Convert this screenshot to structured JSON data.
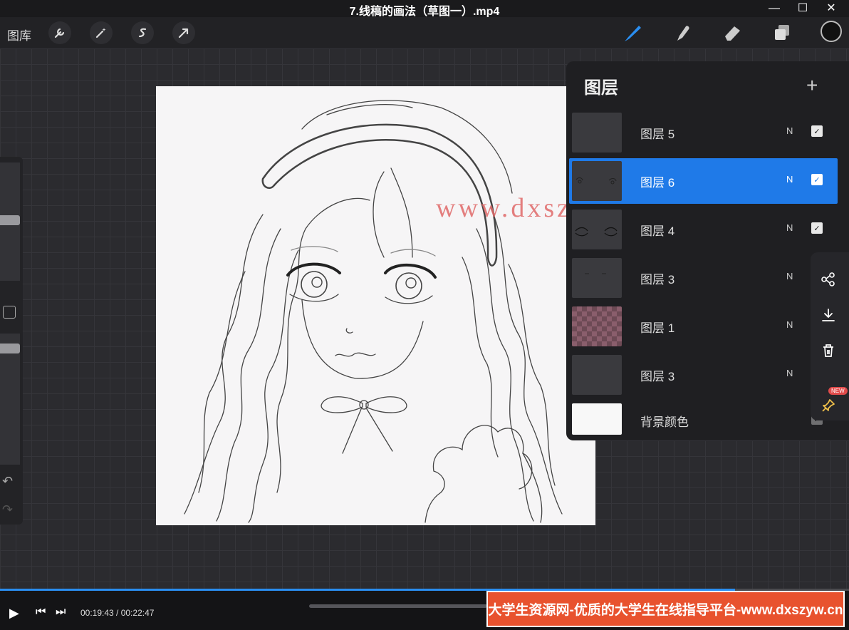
{
  "window": {
    "title": "7.线稿的画法（草图一）.mp4",
    "controls": [
      "minimize-icon",
      "maximize-icon",
      "close-icon"
    ]
  },
  "toolbar": {
    "gallery_label": "图库",
    "left_tools": [
      "wrench-icon",
      "magic-wand-icon",
      "selection-s-icon",
      "move-arrow-icon"
    ],
    "right_tools": [
      "brush-icon",
      "smudge-icon",
      "eraser-icon",
      "layers-icon"
    ],
    "current_color": "#111111"
  },
  "watermark": "www.dxszyw.cn",
  "layers_panel": {
    "title": "图层",
    "add_label": "+",
    "layers": [
      {
        "name": "图层 5",
        "mode": "N",
        "visible": true,
        "active": false
      },
      {
        "name": "图层 6",
        "mode": "N",
        "visible": true,
        "active": true
      },
      {
        "name": "图层 4",
        "mode": "N",
        "visible": true,
        "active": false
      },
      {
        "name": "图层 3",
        "mode": "N",
        "visible": true,
        "active": false
      },
      {
        "name": "图层 1",
        "mode": "N",
        "visible": false,
        "active": false
      },
      {
        "name": "图层 3",
        "mode": "N",
        "visible": false,
        "active": false
      },
      {
        "name": "背景颜色",
        "mode": "",
        "visible": true,
        "active": false
      }
    ],
    "accent_color": "#1f7ae8"
  },
  "floating_actions": {
    "items": [
      "share-icon",
      "download-icon",
      "trash-icon",
      "pin-icon"
    ],
    "new_badge": "NEW"
  },
  "player": {
    "current_time": "00:19:43",
    "duration": "00:22:47",
    "time_display": "00:19:43 / 00:22:47",
    "progress": 0.8656
  },
  "banner": "大学生资源网-优质的大学生在线指导平台-www.dxszyw.cn"
}
